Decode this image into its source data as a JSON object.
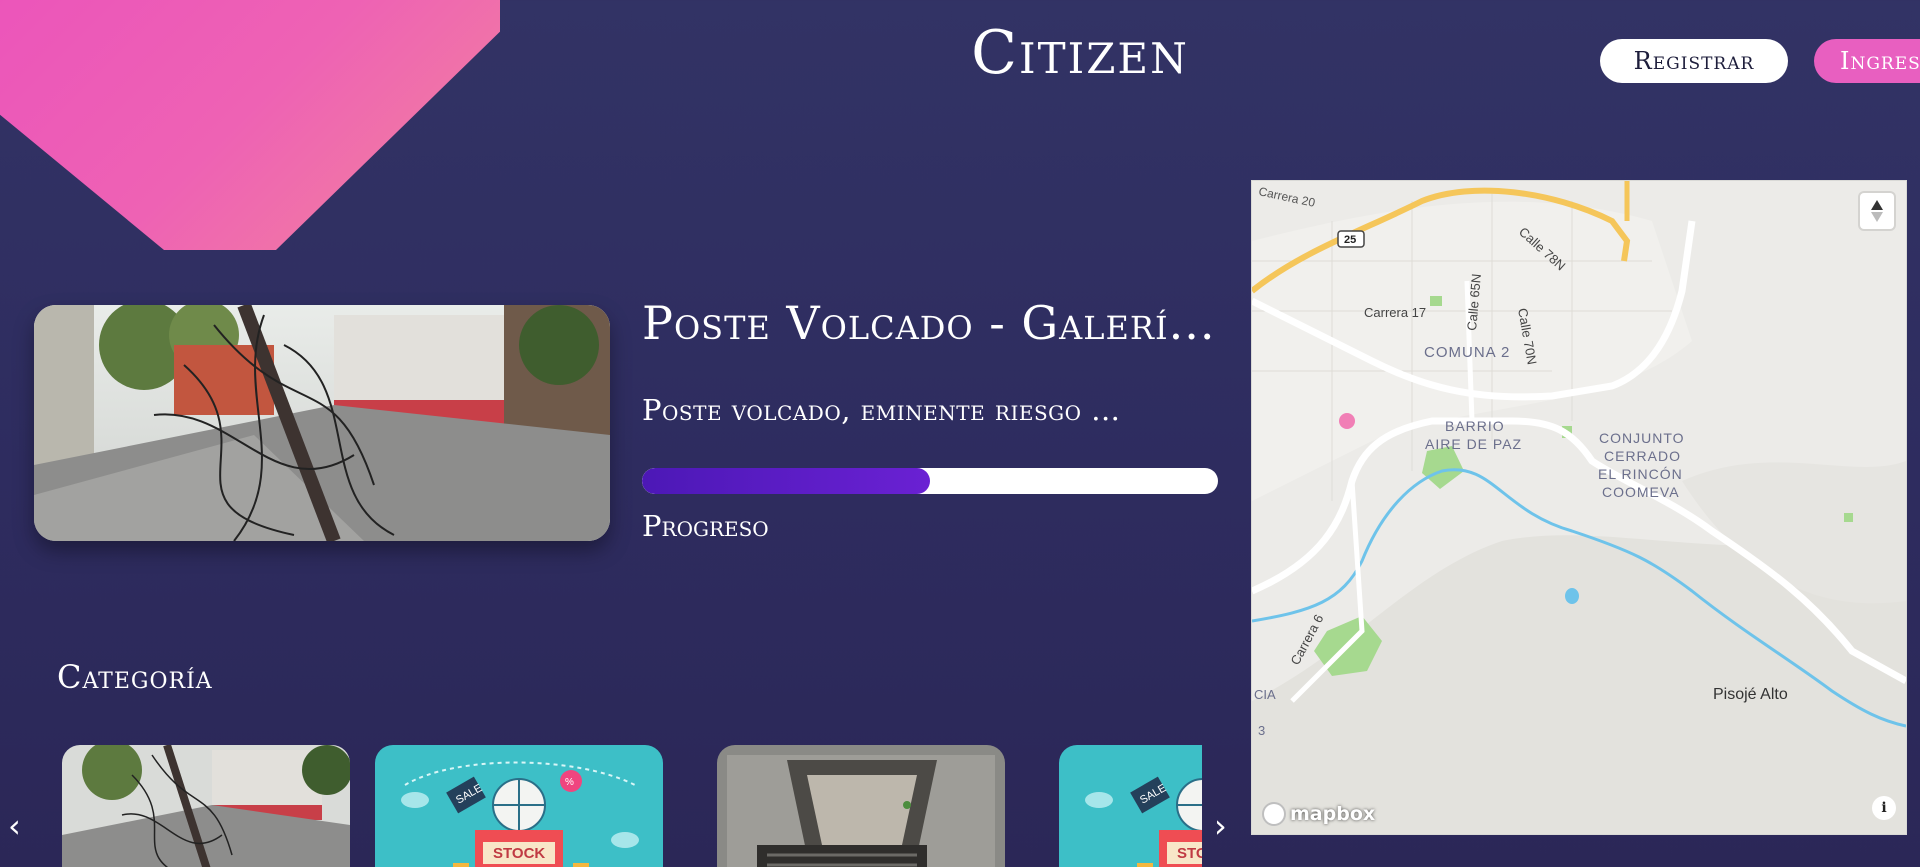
{
  "header": {
    "brand": "Citizen",
    "register_label": "Registrar",
    "login_label": "Ingresar"
  },
  "hero": {
    "title": "Poste Volcado - Galerí...",
    "description": "Poste volcado, eminente riesgo ...",
    "progress_label": "Progreso",
    "progress": 0.5
  },
  "categories": {
    "title": "Categoría",
    "prev_icon": "chevron-left-icon",
    "next_icon": "chevron-right-icon",
    "cards": [
      {
        "name": "fallen-pole-photo"
      },
      {
        "name": "stock-sale-illustration",
        "tags": [
          "SALE",
          "STOCK",
          "%"
        ]
      },
      {
        "name": "storm-drain-photo"
      },
      {
        "name": "stock-sale-illustration",
        "tags": [
          "SALE",
          "STOCK"
        ]
      }
    ]
  },
  "map": {
    "labels": {
      "carrera20": "Carrera 20",
      "route": "25",
      "calle78n": "Calle 78N",
      "calle65n": "Calle 65N",
      "carrera17": "Carrera 17",
      "calle70n": "Calle 70N",
      "comuna2": "COMUNA 2",
      "barrio1": "BARRIO",
      "barrio2": "AIRE DE PAZ",
      "conj1": "CONJUNTO",
      "conj2": "CERRADO",
      "conj3": "EL RINCÓN",
      "conj4": "COOMEVA",
      "carrera6": "Carrera 6",
      "cia": "CIA",
      "three": "3",
      "pisoje": "Pisojé Alto"
    },
    "attribution": "mapbox",
    "compass_icon": "compass-icon",
    "info_icon": "info-icon",
    "colors": {
      "water": "#6ec3ea",
      "park": "#a6d98f",
      "highway": "#f5c65a",
      "marker": "#f17fb6"
    }
  },
  "colors": {
    "background": "#323365",
    "accent_pink": "#e85fc0",
    "progress_fill": "#5a1dc4"
  }
}
